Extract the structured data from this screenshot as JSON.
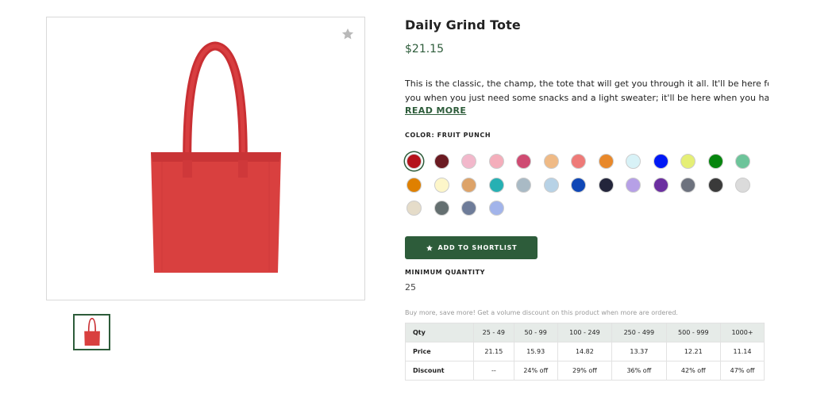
{
  "product": {
    "title": "Daily Grind Tote",
    "price": "$21.15",
    "description_line1": "This is the classic, the champ, the tote that will get you through it all. It'll be here for",
    "description_line2": "you when you just need some snacks and a light sweater; it'll be here when you hav...",
    "read_more": "READ MORE",
    "color_label": "COLOR: FRUIT PUNCH",
    "shortlist_label": "ADD TO SHORTLIST",
    "min_qty_label": "MINIMUM QUANTITY",
    "min_qty_value": "25",
    "volume_note": "Buy more, save more! Get a volume discount on this product when more are ordered.",
    "image_color": "#d9403f"
  },
  "icons": {
    "favorite": "star-icon",
    "shortlist": "star-icon"
  },
  "colors": {
    "brand": "#2d5c3a"
  },
  "swatches": [
    "#b5121b",
    "#6b1b22",
    "#f2b8cb",
    "#f4aebb",
    "#cf4b72",
    "#efba86",
    "#ee7a78",
    "#e8882a",
    "#d8f2f7",
    "#0019f5",
    "#e5ef76",
    "#06850e",
    "#6dc49a",
    "#df8000",
    "#fdf6c9",
    "#dda369",
    "#26b0b3",
    "#a9bac5",
    "#b7d2e6",
    "#0f47b6",
    "#23253b",
    "#b6a0e6",
    "#6b2fa0",
    "#6d727e",
    "#3a3a3a",
    "#dbdbdb",
    "#e5dcc9",
    "#646f70",
    "#6e7c99",
    "#a2b4ea"
  ],
  "pricing": {
    "headers": [
      "Qty",
      "25 - 49",
      "50 - 99",
      "100 - 249",
      "250 - 499",
      "500 - 999",
      "1000+"
    ],
    "price_label": "Price",
    "prices": [
      "21.15",
      "15.93",
      "14.82",
      "13.37",
      "12.21",
      "11.14"
    ],
    "discount_label": "Discount",
    "discounts": [
      "--",
      "24% off",
      "29% off",
      "36% off",
      "42% off",
      "47% off"
    ]
  }
}
